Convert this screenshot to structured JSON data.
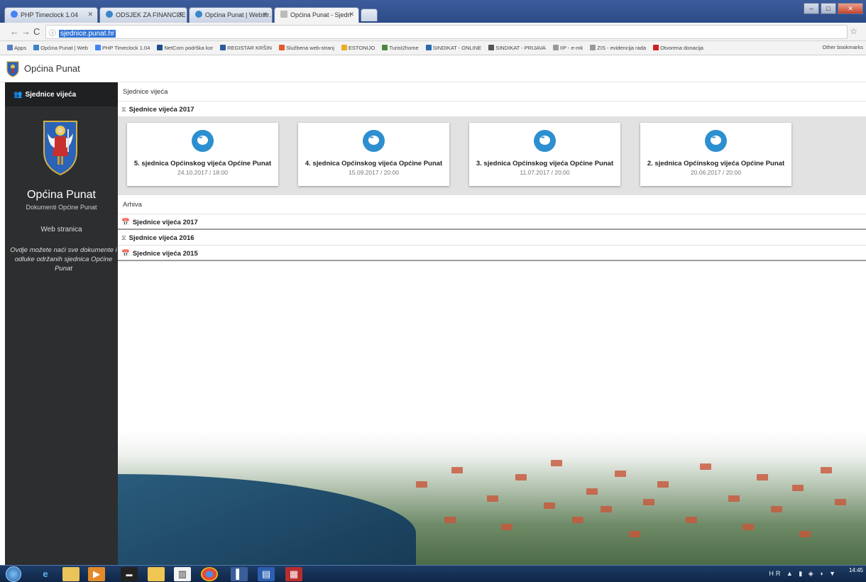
{
  "browser": {
    "tabs": [
      {
        "label": "PHP Timeclock 1.04"
      },
      {
        "label": "ODSJEK ZA FINANCIJE O"
      },
      {
        "label": "Općina Punat | Webstr…"
      },
      {
        "label": "Općina Punat - Sjedn"
      }
    ],
    "url": "sjednice.punat.hr",
    "bookmarks": [
      {
        "label": "Apps",
        "color": "#5a7fc0"
      },
      {
        "label": "Općina Punat | Web",
        "color": "#3a86c8"
      },
      {
        "label": "PHP Timeclock 1.04",
        "color": "#4285f4"
      },
      {
        "label": "NetCom podrška kor",
        "color": "#1c4e8c"
      },
      {
        "label": "REGISTAR KRŠIN",
        "color": "#2c5aa0"
      },
      {
        "label": "Službena web-stranj",
        "color": "#e05a2a"
      },
      {
        "label": "ESTONIJO",
        "color": "#e8b020"
      },
      {
        "label": "Turist2home",
        "color": "#4a8a3a"
      },
      {
        "label": "SINDIKAT - ONLINE",
        "color": "#2a6ab0"
      },
      {
        "label": "SINDIKAT - PRIJAVA",
        "color": "#555555"
      },
      {
        "label": "IIP - e-mk",
        "color": "#999999"
      },
      {
        "label": "ZIS - evidencija rada",
        "color": "#999999"
      },
      {
        "label": "Otvorena donacija",
        "color": "#d02020"
      }
    ],
    "other_bookmarks": "Other bookmarks"
  },
  "header": {
    "brand": "Općina Punat"
  },
  "sidebar": {
    "menu_item": "Sjednice vijeća",
    "title": "Općina Punat",
    "subtitle": "Dokumenti Općine Punat",
    "link": "Web stranica",
    "description": "Ovdje možete naći sve dokumente i odluke održanih sjednica Općine Punat"
  },
  "main": {
    "section_title": "Sjednice vijeća",
    "current_group": "Sjednice vijeća 2017",
    "cards": [
      {
        "title": "5. sjednica Općinskog vijeća Općine Punat",
        "date": "24.10.2017 / 18:00"
      },
      {
        "title": "4. sjednica Općinskog vijeća Općine Punat",
        "date": "15.09.2017 / 20:00"
      },
      {
        "title": "3. sjednica Općinskog vijeća Općine Punat",
        "date": "11.07.2017 / 20:00"
      },
      {
        "title": "2. sjednica Općinskog vijeća Općine Punat",
        "date": "20.06.2017 / 20:00"
      }
    ],
    "archive_title": "Arhiva",
    "archive": [
      {
        "label": "Sjednice vijeća 2017"
      },
      {
        "label": "Sjednice vijeća 2016"
      },
      {
        "label": "Sjednice vijeća 2015"
      }
    ]
  },
  "taskbar": {
    "tray": "HR",
    "time": "14:45"
  }
}
